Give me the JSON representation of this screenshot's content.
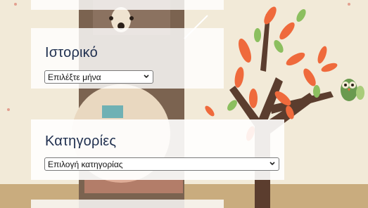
{
  "archive": {
    "title": "Ιστορικό",
    "select_value": "Επιλέξτε μήνα"
  },
  "categories": {
    "title": "Κατηγορίες",
    "select_value": "Επιλογή κατηγορίας"
  },
  "icons": {
    "dropdown": "chevron-down-icon"
  },
  "colors": {
    "background": "#f2ead8",
    "tree_trunk": "#5b3d2e",
    "leaf_orange": "#ef6a3c",
    "leaf_green": "#8cbf5f",
    "title_navy": "#1f2f4f"
  }
}
